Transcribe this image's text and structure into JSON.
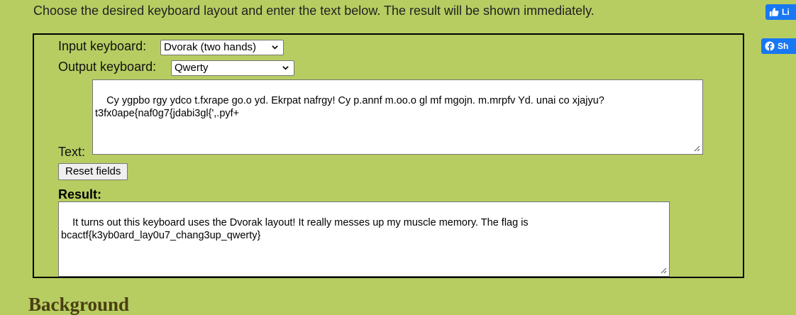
{
  "intro_text": "Choose the desired keyboard layout and enter the text below. The result will be shown immediately.",
  "social": {
    "like_label": "Li",
    "share_label": "Sh",
    "brand_color": "#1877f2"
  },
  "converter": {
    "input_keyboard_label": "Input keyboard:",
    "input_keyboard_value": "Dvorak (two hands)",
    "output_keyboard_label": "Output keyboard:",
    "output_keyboard_value": "Qwerty",
    "text_label": "Text:",
    "text_value": "Cy ygpbo rgy ydco t.fxrape go.o yd. Ekrpat nafrgy! Cy p.annf m.oo.o gl mf mgojn. m.mrpfv Yd. unai co xjajyu?\nt3fx0ape{naf0g7{jdabi3gl{',.pyf+",
    "reset_button_label": "Reset fields",
    "result_label": "Result:",
    "result_value": "It turns out this keyboard uses the Dvorak layout! It really messes up my muscle memory. The flag is\nbcactf{k3yb0ard_lay0u7_chang3up_qwerty}"
  },
  "section_heading": "Background",
  "colors": {
    "page_background": "#b7cd62",
    "heading_color": "#4a3e12",
    "box_border": "#000000"
  }
}
